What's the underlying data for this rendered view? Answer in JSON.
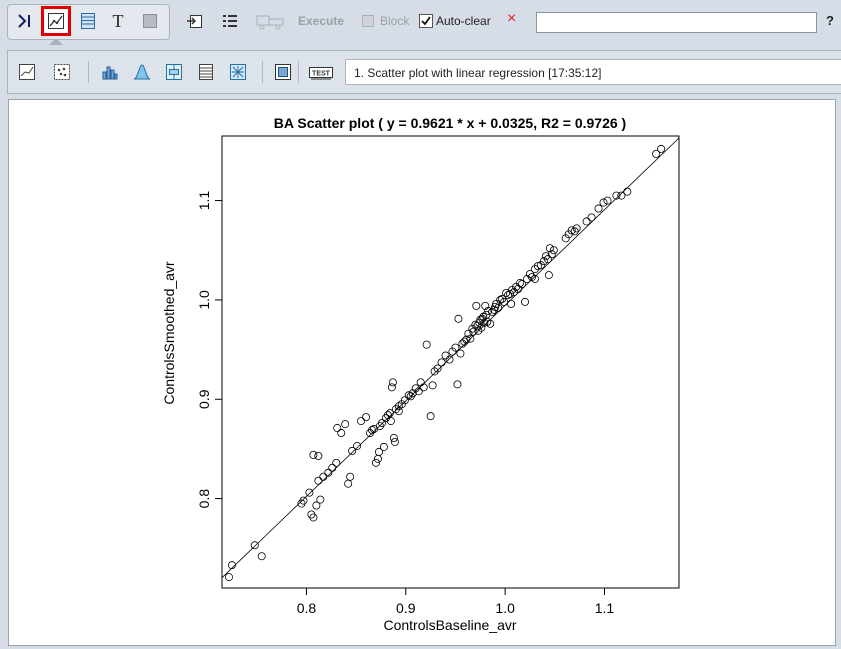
{
  "toolbar": {
    "execute_label": "Execute",
    "block_label": "Block",
    "autoclear_label": "Auto-clear",
    "autoclear_checked": true,
    "close_glyph": "×",
    "help_glyph": "?",
    "search_value": ""
  },
  "plot_toolbar": {
    "plot_selection": "1. Scatter plot with linear regression [17:35:12]"
  },
  "chart_data": {
    "type": "scatter",
    "title": "BA Scatter plot ( y = 0.9621 * x + 0.0325, R2 = 0.9726 )",
    "xlabel": "ControlsBaseline_avr",
    "ylabel": "ControlsSmoothed_avr",
    "xlim": [
      0.715,
      1.175
    ],
    "ylim": [
      0.71,
      1.165
    ],
    "x_ticks": [
      "0.8",
      "0.9",
      "1.0",
      "1.1"
    ],
    "y_ticks": [
      "0.8",
      "0.9",
      "1.0",
      "1.1"
    ],
    "regression": {
      "slope": 0.9621,
      "intercept": 0.0325
    },
    "points": [
      [
        0.722,
        0.721
      ],
      [
        0.725,
        0.733
      ],
      [
        0.748,
        0.753
      ],
      [
        0.755,
        0.742
      ],
      [
        0.795,
        0.795
      ],
      [
        0.797,
        0.798
      ],
      [
        0.803,
        0.806
      ],
      [
        0.805,
        0.784
      ],
      [
        0.807,
        0.781
      ],
      [
        0.81,
        0.793
      ],
      [
        0.812,
        0.818
      ],
      [
        0.814,
        0.799
      ],
      [
        0.817,
        0.822
      ],
      [
        0.822,
        0.826
      ],
      [
        0.826,
        0.831
      ],
      [
        0.83,
        0.836
      ],
      [
        0.807,
        0.844
      ],
      [
        0.812,
        0.843
      ],
      [
        0.831,
        0.871
      ],
      [
        0.835,
        0.866
      ],
      [
        0.839,
        0.875
      ],
      [
        0.842,
        0.815
      ],
      [
        0.844,
        0.822
      ],
      [
        0.846,
        0.848
      ],
      [
        0.851,
        0.853
      ],
      [
        0.855,
        0.878
      ],
      [
        0.86,
        0.882
      ],
      [
        0.864,
        0.866
      ],
      [
        0.866,
        0.869
      ],
      [
        0.868,
        0.87
      ],
      [
        0.87,
        0.836
      ],
      [
        0.872,
        0.84
      ],
      [
        0.873,
        0.847
      ],
      [
        0.874,
        0.873
      ],
      [
        0.876,
        0.876
      ],
      [
        0.878,
        0.852
      ],
      [
        0.88,
        0.881
      ],
      [
        0.882,
        0.884
      ],
      [
        0.884,
        0.886
      ],
      [
        0.885,
        0.878
      ],
      [
        0.886,
        0.912
      ],
      [
        0.887,
        0.917
      ],
      [
        0.888,
        0.861
      ],
      [
        0.889,
        0.857
      ],
      [
        0.89,
        0.89
      ],
      [
        0.893,
        0.893
      ],
      [
        0.896,
        0.895
      ],
      [
        0.899,
        0.899
      ],
      [
        0.903,
        0.904
      ],
      [
        0.907,
        0.906
      ],
      [
        0.91,
        0.911
      ],
      [
        0.913,
        0.908
      ],
      [
        0.918,
        0.912
      ],
      [
        0.921,
        0.955
      ],
      [
        0.925,
        0.883
      ],
      [
        0.927,
        0.914
      ],
      [
        0.929,
        0.928
      ],
      [
        0.932,
        0.931
      ],
      [
        0.936,
        0.937
      ],
      [
        0.94,
        0.944
      ],
      [
        0.944,
        0.94
      ],
      [
        0.947,
        0.948
      ],
      [
        0.95,
        0.952
      ],
      [
        0.952,
        0.915
      ],
      [
        0.953,
        0.981
      ],
      [
        0.955,
        0.946
      ],
      [
        0.957,
        0.956
      ],
      [
        0.959,
        0.958
      ],
      [
        0.961,
        0.96
      ],
      [
        0.963,
        0.966
      ],
      [
        0.965,
        0.961
      ],
      [
        0.967,
        0.971
      ],
      [
        0.968,
        0.968
      ],
      [
        0.97,
        0.975
      ],
      [
        0.971,
        0.994
      ],
      [
        0.972,
        0.974
      ],
      [
        0.973,
        0.969
      ],
      [
        0.974,
        0.977
      ],
      [
        0.975,
        0.98
      ],
      [
        0.976,
        0.972
      ],
      [
        0.977,
        0.981
      ],
      [
        0.978,
        0.983
      ],
      [
        0.979,
        0.977
      ],
      [
        0.98,
        0.994
      ],
      [
        0.981,
        0.985
      ],
      [
        0.982,
        0.978
      ],
      [
        0.983,
        0.989
      ],
      [
        0.985,
        0.976
      ],
      [
        0.987,
        0.988
      ],
      [
        0.989,
        0.99
      ],
      [
        0.99,
        0.993
      ],
      [
        0.991,
        0.996
      ],
      [
        0.993,
        0.992
      ],
      [
        0.995,
        1.0
      ],
      [
        0.997,
        1.001
      ],
      [
        0.999,
        0.998
      ],
      [
        1.001,
        1.007
      ],
      [
        1.003,
        1.005
      ],
      [
        1.005,
        1.006
      ],
      [
        1.006,
        0.996
      ],
      [
        1.007,
        1.01
      ],
      [
        1.009,
        1.008
      ],
      [
        1.011,
        1.013
      ],
      [
        1.013,
        1.011
      ],
      [
        1.015,
        1.017
      ],
      [
        1.017,
        1.016
      ],
      [
        1.02,
        0.998
      ],
      [
        1.022,
        1.021
      ],
      [
        1.025,
        1.026
      ],
      [
        1.027,
        1.023
      ],
      [
        1.03,
        1.031
      ],
      [
        1.033,
        1.034
      ],
      [
        1.036,
        1.035
      ],
      [
        1.039,
        1.039
      ],
      [
        1.041,
        1.044
      ],
      [
        1.043,
        1.041
      ],
      [
        1.045,
        1.052
      ],
      [
        1.047,
        1.046
      ],
      [
        1.049,
        1.05
      ],
      [
        1.061,
        1.062
      ],
      [
        1.064,
        1.066
      ],
      [
        1.067,
        1.07
      ],
      [
        1.07,
        1.069
      ],
      [
        1.072,
        1.072
      ],
      [
        1.082,
        1.079
      ],
      [
        1.087,
        1.083
      ],
      [
        1.094,
        1.092
      ],
      [
        1.099,
        1.098
      ],
      [
        1.103,
        1.1
      ],
      [
        1.112,
        1.105
      ],
      [
        1.117,
        1.105
      ],
      [
        1.123,
        1.109
      ],
      [
        1.152,
        1.147
      ],
      [
        1.157,
        1.152
      ],
      [
        1.044,
        1.025
      ],
      [
        1.03,
        1.021
      ],
      [
        0.893,
        0.888
      ],
      [
        0.905,
        0.903
      ],
      [
        0.915,
        0.917
      ]
    ]
  }
}
